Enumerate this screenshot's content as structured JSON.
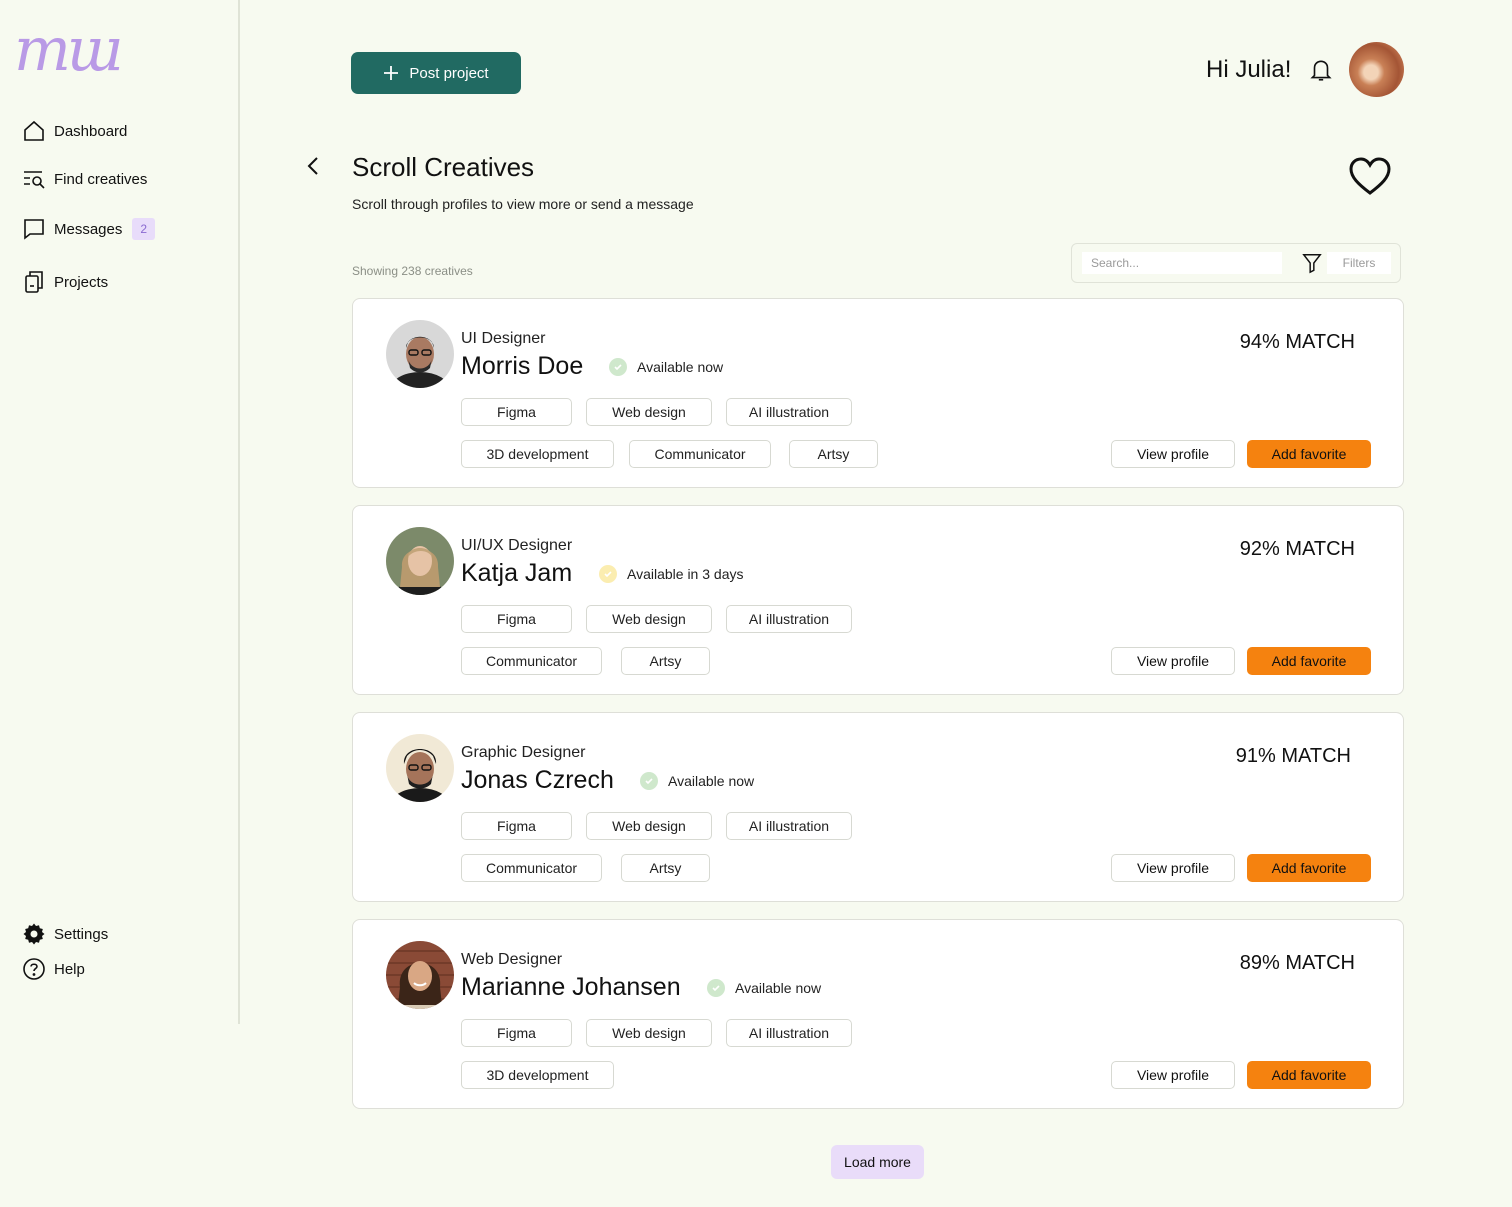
{
  "app": {
    "logo_text": "mu",
    "brand_color": "#b99ae6",
    "accent": "#216a62",
    "favorite_color": "#f5820f"
  },
  "sidebar": {
    "items": [
      {
        "label": "Dashboard",
        "icon": "home-icon"
      },
      {
        "label": "Find creatives",
        "icon": "search-list-icon"
      },
      {
        "label": "Messages",
        "icon": "chat-icon",
        "badge": "2"
      },
      {
        "label": "Projects",
        "icon": "clipboard-icon"
      }
    ],
    "bottom": [
      {
        "label": "Settings",
        "icon": "gear-icon"
      },
      {
        "label": "Help",
        "icon": "help-icon"
      }
    ]
  },
  "header": {
    "post_label": "Post project",
    "greeting": "Hi Julia!"
  },
  "page": {
    "title": "Scroll Creatives",
    "subtitle": "Scroll through profiles to view more or send a message",
    "showing": "Showing 238 creatives",
    "search_placeholder": "Search...",
    "filters_label": "Filters"
  },
  "cards": [
    {
      "role": "UI Designer",
      "name": "Morris Doe",
      "availability": "Available now",
      "status": "green",
      "match": "94% MATCH",
      "tags": [
        "Figma",
        "Web design",
        "AI illustration",
        "3D development",
        "Communicator",
        "Artsy"
      ]
    },
    {
      "role": "UI/UX Designer",
      "name": "Katja Jam",
      "availability": "Available in 3 days",
      "status": "yellow",
      "match": "92% MATCH",
      "tags": [
        "Figma",
        "Web design",
        "AI illustration",
        "Communicator",
        "Artsy"
      ]
    },
    {
      "role": "Graphic Designer",
      "name": "Jonas Czrech",
      "availability": "Available now",
      "status": "green",
      "match": "91% MATCH",
      "tags": [
        "Figma",
        "Web design",
        "AI illustration",
        "Communicator",
        "Artsy"
      ]
    },
    {
      "role": "Web Designer",
      "name": "Marianne Johansen",
      "availability": "Available now",
      "status": "green",
      "match": "89% MATCH",
      "tags": [
        "Figma",
        "Web design",
        "AI illustration",
        "3D development"
      ]
    }
  ],
  "card_actions": {
    "view": "View profile",
    "favorite": "Add favorite"
  },
  "load_more": "Load more"
}
